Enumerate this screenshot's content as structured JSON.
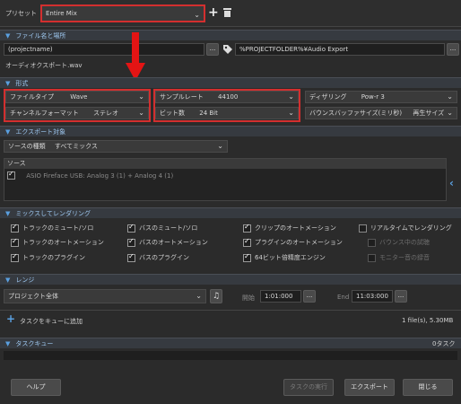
{
  "preset": {
    "label": "プリセット",
    "value": "Entire Mix"
  },
  "sections": {
    "file": "ファイル名と場所",
    "format": "形式",
    "export_target": "エクスポート対象",
    "mix_render": "ミックスしてレンダリング",
    "range": "レンジ",
    "task_queue": "タスクキュー"
  },
  "file": {
    "filename": "(projectname)",
    "browse": "...",
    "path": "%PROJECTFOLDER%¥Audio Export",
    "output_name": "オーディオクスポート.wav"
  },
  "format": {
    "file_type_label": "ファイルタイプ",
    "file_type_value": "Wave",
    "channel_label": "チャンネルフォーマット",
    "channel_value": "ステレオ",
    "sample_rate_label": "サンプルレート",
    "sample_rate_value": "44100",
    "bit_depth_label": "ビット数",
    "bit_depth_value": "24 Bit",
    "dither_label": "ディザリング",
    "dither_value": "Pow-r 3",
    "bounce_label": "バウンスバッファサイズ(ミリ秒)",
    "bounce_value": "再生サイズ"
  },
  "export_target": {
    "source_type_label": "ソースの種類",
    "source_type_value": "すべてミックス",
    "source_header": "ソース",
    "source_item": "ASIO Fireface USB: Analog 3 (1) + Analog 4 (1)"
  },
  "mix": {
    "track_mute_solo": "トラックのミュート/ソロ",
    "track_automation": "トラックのオートメーション",
    "track_plugins": "トラックのプラグイン",
    "bus_mute_solo": "バスのミュート/ソロ",
    "bus_automation": "バスのオートメーション",
    "bus_plugins": "バスのプラグイン",
    "clip_automation": "クリップのオートメーション",
    "plugin_automation": "プラグインのオートメーション",
    "engine_64bit": "64ビット倍精度エンジン",
    "realtime_render": "リアルタイムでレンダリング",
    "bounce_listen": "バウンス中の試聴",
    "monitor_record": "モニター音の録音"
  },
  "range": {
    "scope_value": "プロジェクト全体",
    "start_label": "開始",
    "start_value": "1:01:000",
    "end_label": "End",
    "end_value": "11:03:000",
    "dots": "..."
  },
  "queue": {
    "add_label": "タスクをキューに追加",
    "size_info": "1 file(s), 5.30MB",
    "task_count": "0タスク"
  },
  "buttons": {
    "help": "ヘルプ",
    "run_tasks": "タスクの実行",
    "export": "エクスポート",
    "close": "閉じる"
  }
}
